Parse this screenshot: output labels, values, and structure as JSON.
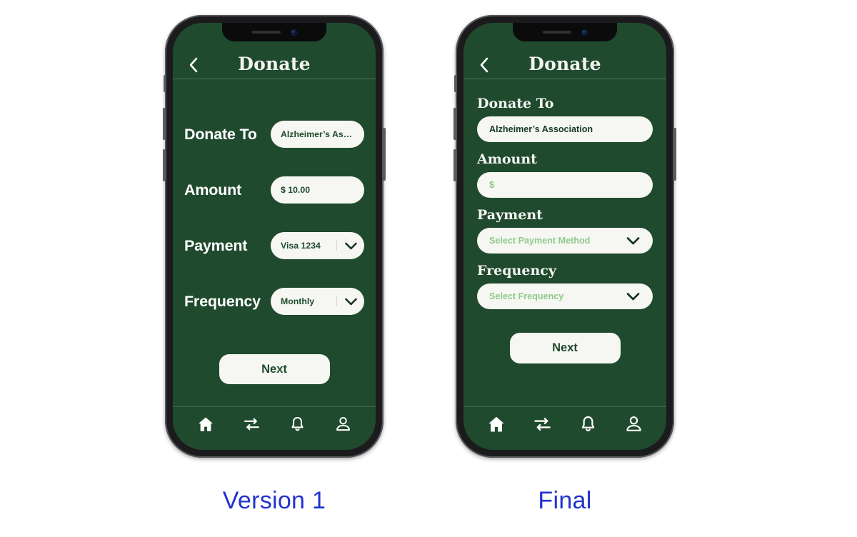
{
  "app": {
    "title": "Donate",
    "back_icon": "chevron-left-icon",
    "brand_green": "#204A2E",
    "field_bg": "#F6F7F2",
    "placeholder_green": "#8FC98C",
    "caption_blue": "#2233CC"
  },
  "version1": {
    "caption": "Version 1",
    "title": "Donate",
    "fields": [
      {
        "label": "Donate To",
        "value": "Alzheimer’s Assoc.",
        "type": "text"
      },
      {
        "label": "Amount",
        "value": "$ 10.00",
        "type": "text"
      },
      {
        "label": "Payment",
        "value": "Visa 1234",
        "type": "select"
      },
      {
        "label": "Frequency",
        "value": "Monthly",
        "type": "select"
      }
    ],
    "next_label": "Next"
  },
  "final": {
    "caption": "Final",
    "title": "Donate",
    "fields": [
      {
        "label": "Donate To",
        "value": "Alzheimer’s Association",
        "type": "text",
        "is_placeholder": false
      },
      {
        "label": "Amount",
        "value": "$",
        "type": "text",
        "is_placeholder": true
      },
      {
        "label": "Payment",
        "value": "Select Payment Method",
        "type": "select",
        "is_placeholder": true
      },
      {
        "label": "Frequency",
        "value": "Select Frequency",
        "type": "select",
        "is_placeholder": true
      }
    ],
    "next_label": "Next"
  },
  "tabbar": {
    "items": [
      {
        "icon": "home-icon",
        "label": "Home"
      },
      {
        "icon": "transfer-arrows-icon",
        "label": "Transfer"
      },
      {
        "icon": "bell-icon",
        "label": "Notifications"
      },
      {
        "icon": "person-icon",
        "label": "Profile"
      }
    ]
  }
}
